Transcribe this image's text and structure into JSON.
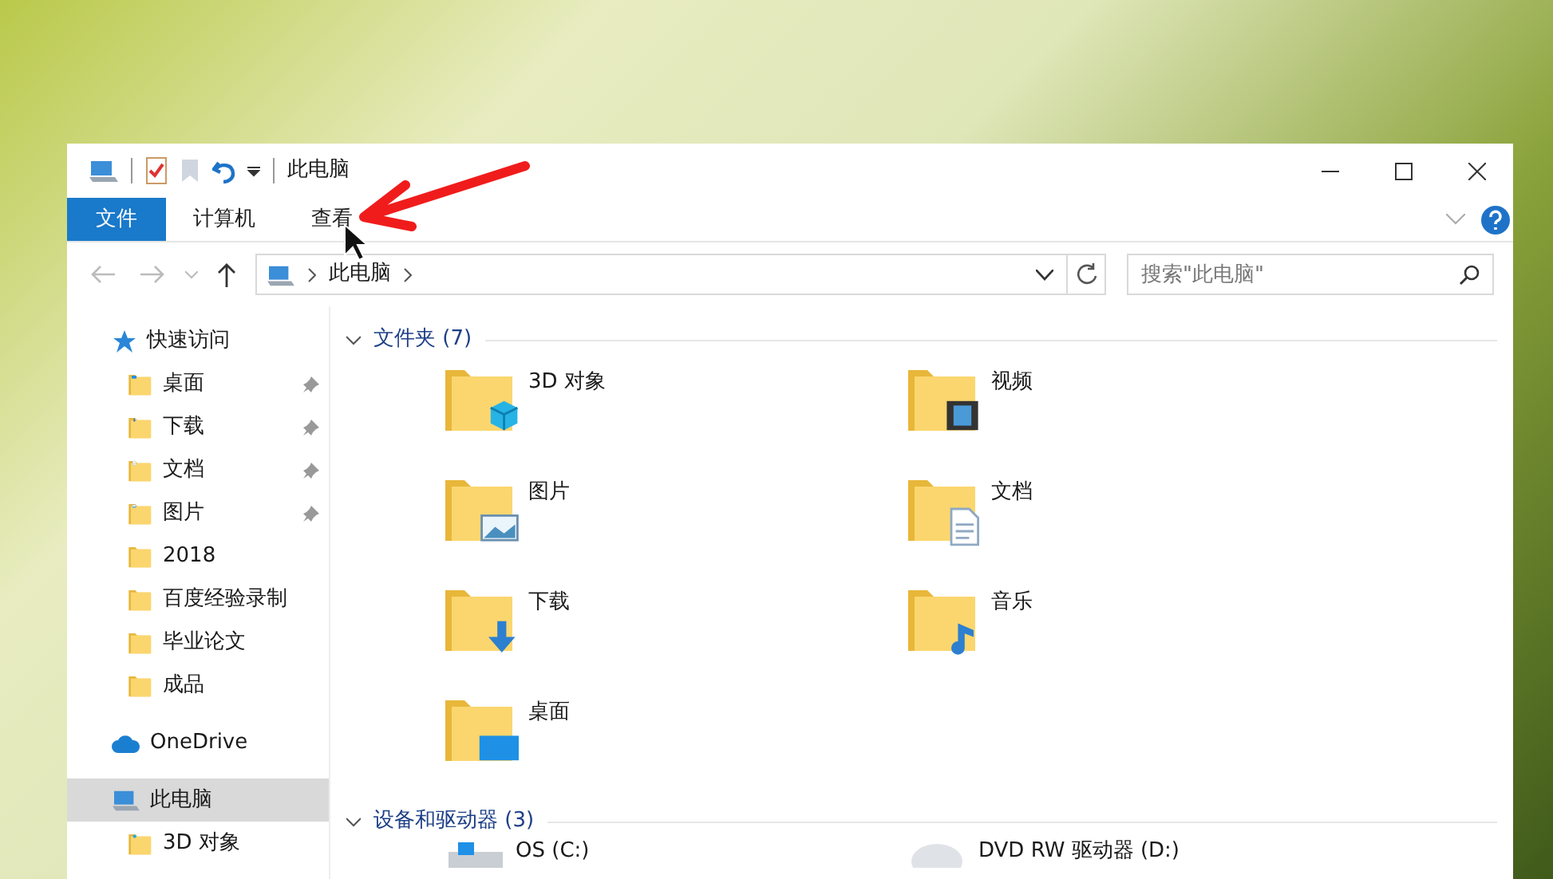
{
  "window": {
    "title": "此电脑"
  },
  "ribbon_tabs": [
    {
      "label": "文件",
      "kind": "file"
    },
    {
      "label": "计算机",
      "kind": "tab"
    },
    {
      "label": "查看",
      "kind": "tab"
    }
  ],
  "address_bar": {
    "path": [
      "此电脑"
    ]
  },
  "search": {
    "placeholder": "搜索\"此电脑\""
  },
  "navigation": [
    {
      "label": "快速访问",
      "kind": "star",
      "selected": false,
      "children": [
        {
          "label": "桌面",
          "kind": "desktop",
          "pinned": true,
          "selected": false
        },
        {
          "label": "下载",
          "kind": "download",
          "pinned": true,
          "selected": false
        },
        {
          "label": "文档",
          "kind": "document",
          "pinned": true,
          "selected": false
        },
        {
          "label": "图片",
          "kind": "picture",
          "pinned": true,
          "selected": false
        },
        {
          "label": "2018",
          "kind": "folder",
          "pinned": false,
          "selected": false
        },
        {
          "label": "百度经验录制",
          "kind": "folder",
          "pinned": false,
          "selected": false
        },
        {
          "label": "毕业论文",
          "kind": "folder",
          "pinned": false,
          "selected": false
        },
        {
          "label": "成品",
          "kind": "folder",
          "pinned": false,
          "selected": false
        }
      ]
    },
    {
      "label": "OneDrive",
      "kind": "cloud",
      "selected": false
    },
    {
      "label": "此电脑",
      "kind": "computer",
      "selected": true,
      "children": [
        {
          "label": "3D 对象",
          "kind": "cube",
          "pinned": false,
          "selected": false
        }
      ]
    }
  ],
  "sections": [
    {
      "title": "文件夹 (7)",
      "expanded": true,
      "items": [
        {
          "label": "3D 对象",
          "kind": "cube"
        },
        {
          "label": "视频",
          "kind": "video"
        },
        {
          "label": "图片",
          "kind": "picture"
        },
        {
          "label": "文档",
          "kind": "document"
        },
        {
          "label": "下载",
          "kind": "download"
        },
        {
          "label": "音乐",
          "kind": "music"
        },
        {
          "label": "桌面",
          "kind": "desktop"
        }
      ]
    },
    {
      "title": "设备和驱动器 (3)",
      "expanded": true,
      "items": [
        {
          "label": "OS (C:)",
          "kind": "harddisk"
        },
        {
          "label": "DVD RW 驱动器 (D:)",
          "kind": "disc"
        }
      ]
    }
  ]
}
